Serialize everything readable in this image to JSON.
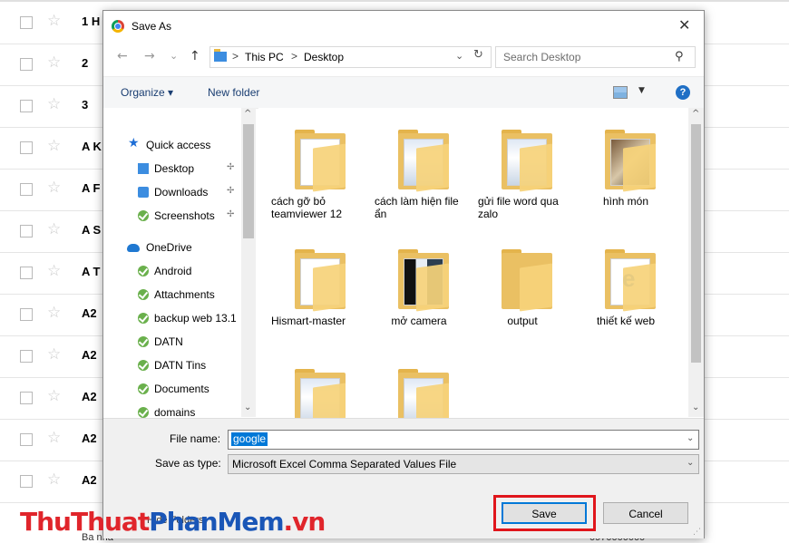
{
  "background": {
    "rows": [
      "1 H",
      "2",
      "3",
      "A K",
      "A F",
      "A S",
      "A T",
      "A2",
      "A2",
      "A2",
      "A2",
      "A2"
    ],
    "bottom_left": "Ba  nha",
    "bottom_right": "0970000000"
  },
  "dialog": {
    "title": "Save As",
    "close_glyph": "✕",
    "nav": {
      "back": "←",
      "forward": "→",
      "recent": "⌄",
      "up": "↑",
      "path": [
        "This PC",
        "Desktop"
      ],
      "separator": ">",
      "dropdown": "⌄",
      "refresh": "↻"
    },
    "search": {
      "placeholder": "Search Desktop",
      "icon": "⚲"
    },
    "toolbar": {
      "organize": "Organize ▾",
      "new_folder": "New folder",
      "view_dd": "▼",
      "help": "?"
    },
    "nav_pane": {
      "items": [
        {
          "label": "Quick access",
          "icon": "star"
        },
        {
          "label": "Desktop",
          "icon": "desktop",
          "pinned": true
        },
        {
          "label": "Downloads",
          "icon": "download",
          "pinned": true
        },
        {
          "label": "Screenshots",
          "icon": "check",
          "pinned": true
        },
        {
          "label": "OneDrive",
          "icon": "cloud"
        },
        {
          "label": "Android",
          "icon": "check"
        },
        {
          "label": "Attachments",
          "icon": "check"
        },
        {
          "label": "backup web 13.1",
          "icon": "check"
        },
        {
          "label": "DATN",
          "icon": "check"
        },
        {
          "label": "DATN Tins",
          "icon": "check"
        },
        {
          "label": "Documents",
          "icon": "check"
        },
        {
          "label": "domains",
          "icon": "check"
        }
      ],
      "pin_glyph": "📌"
    },
    "folders": [
      {
        "label": "cách gỡ bỏ teamviewer 12",
        "thumb": "doc"
      },
      {
        "label": "cách làm hiện file ẩn",
        "thumb": "doc"
      },
      {
        "label": "gửi file word qua zalo",
        "thumb": "img3"
      },
      {
        "label": "hình món",
        "thumb": "img1"
      },
      {
        "label": "Hismart-master",
        "thumb": "doc"
      },
      {
        "label": "mở camera",
        "thumb": "img2"
      },
      {
        "label": "output",
        "thumb": "empty"
      },
      {
        "label": "thiết kế web",
        "thumb": "web"
      },
      {
        "label": "",
        "thumb": "img3"
      },
      {
        "label": "",
        "thumb": "img3"
      }
    ],
    "form": {
      "file_name_label": "File name:",
      "file_name_value": "google",
      "save_type_label": "Save as type:",
      "save_type_value": "Microsoft Excel Comma Separated Values File",
      "hide_folders": "Hide Folders",
      "save_button": "Save",
      "cancel_button": "Cancel"
    }
  },
  "watermark": {
    "part1": "ThuThuat",
    "part2": "PhanMem",
    "part3": ".vn"
  },
  "colors": {
    "accent": "#0078d7",
    "highlight": "#e0161c",
    "folder": "#eac063"
  }
}
